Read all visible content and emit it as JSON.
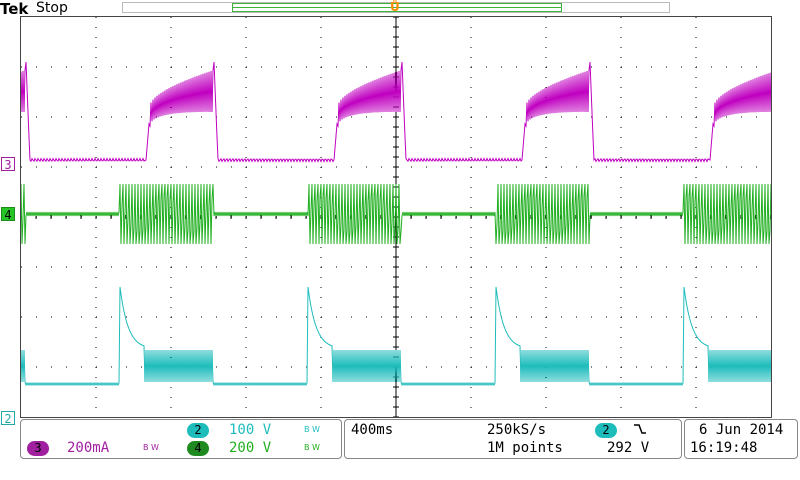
{
  "header": {
    "brand": "Tek",
    "state": "Stop",
    "trigger_position_icon": "trigger-position-marker"
  },
  "channel_markers": {
    "ch3": "3",
    "ch4": "4",
    "ch2": "2"
  },
  "channels": {
    "ch2": {
      "number": "2",
      "scale": "100 V",
      "bw": "B W",
      "color": "#1fbcbc"
    },
    "ch3": {
      "number": "3",
      "scale": "200mA",
      "bw": "B W",
      "color": "#a020a0"
    },
    "ch4": {
      "number": "4",
      "scale": "200 V",
      "bw": "B W",
      "color": "#22b022"
    }
  },
  "timebase": {
    "time_per_div": "400ms",
    "sample_rate": "250kS/s",
    "record_length": "1M points",
    "trigger_source": "2",
    "trigger_slope_icon": "falling-edge-icon",
    "trigger_level": "292 V"
  },
  "datetime": {
    "date": "6 Jun 2014",
    "time": "16:19:48"
  },
  "colors": {
    "ch3": "#c000c0",
    "ch4": "#22b022",
    "ch2": "#1fbcbc",
    "grid": "#000000",
    "trigger_marker": "#ff8c00"
  }
}
